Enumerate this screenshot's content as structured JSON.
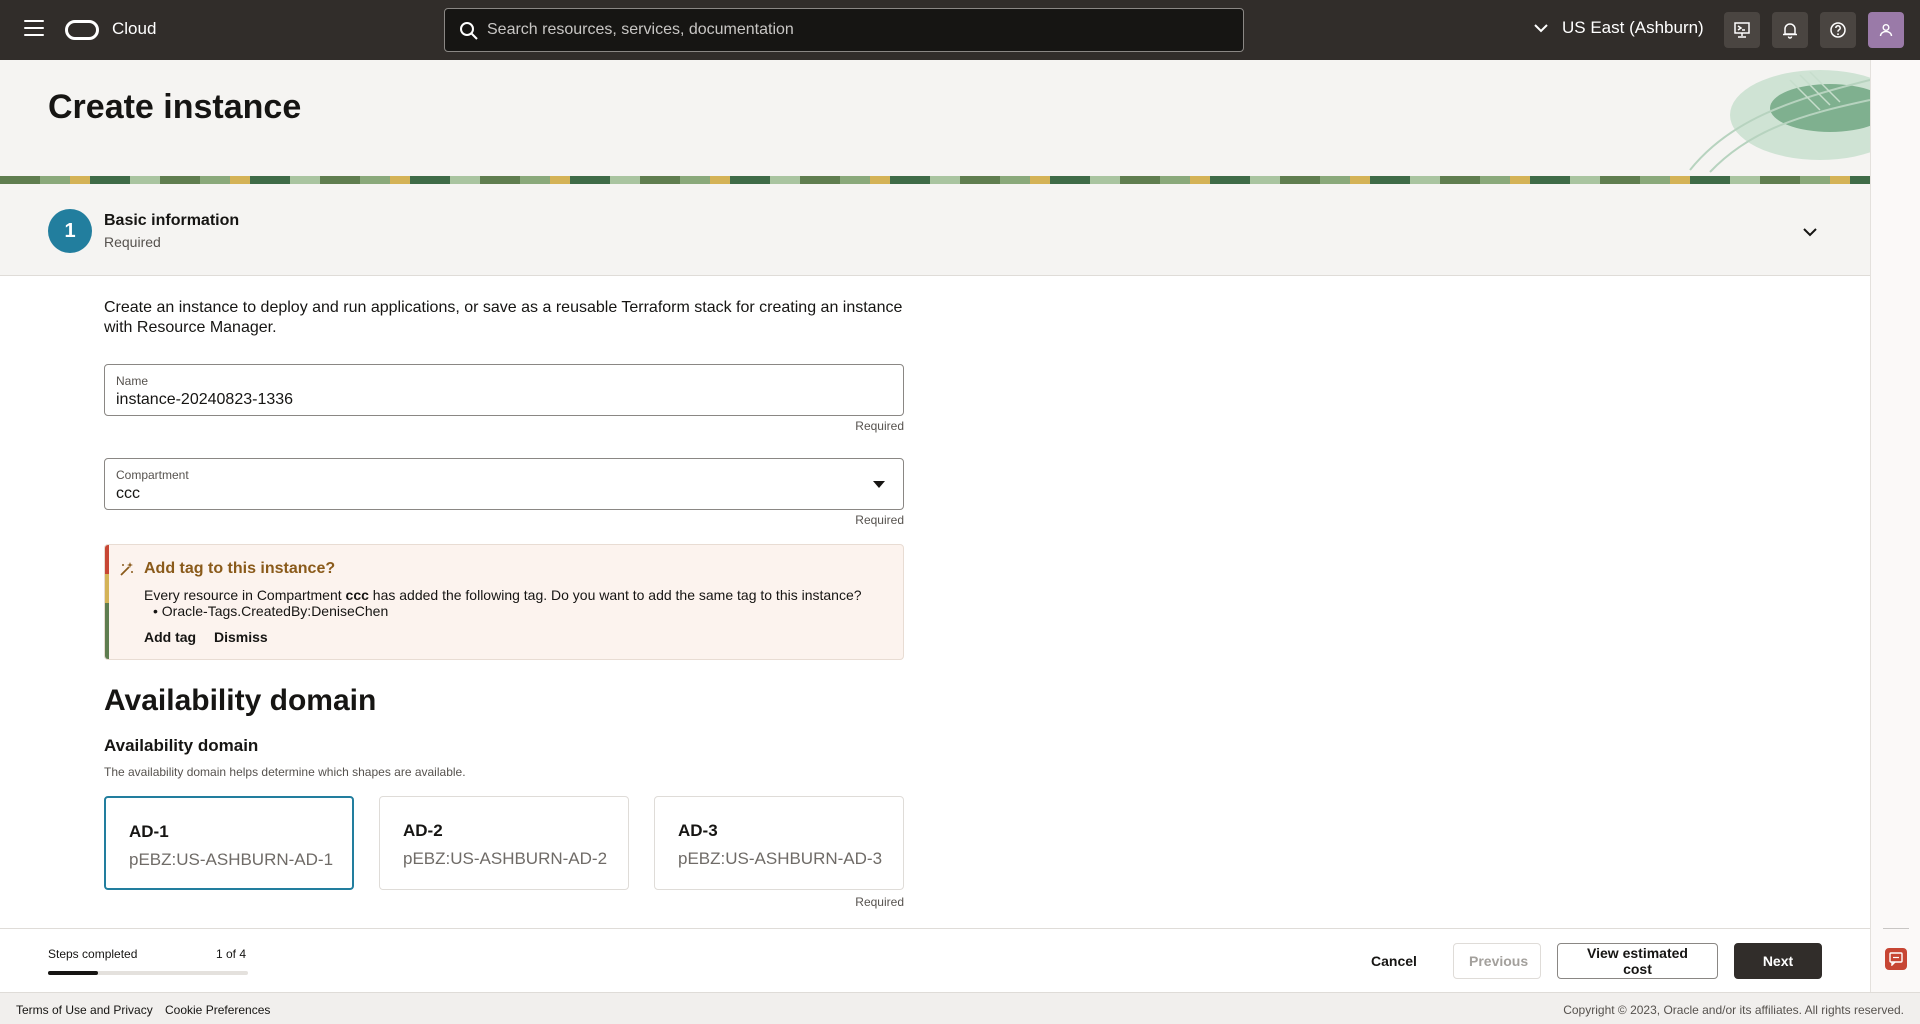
{
  "topbar": {
    "brand": "Cloud",
    "search_placeholder": "Search resources, services, documentation",
    "region": "US East (Ashburn)"
  },
  "header": {
    "title": "Create instance"
  },
  "step": {
    "number": "1",
    "title": "Basic information",
    "subtitle": "Required"
  },
  "main": {
    "intro": "Create an instance to deploy and run applications, or save as a reusable Terraform stack for creating an instance with Resource Manager.",
    "name_field": {
      "label": "Name",
      "value": "instance-20240823-1336",
      "required": "Required"
    },
    "compartment_field": {
      "label": "Compartment",
      "value": "ccc",
      "required": "Required"
    },
    "tag_suggestion": {
      "title": "Add tag to this instance?",
      "text_before": "Every resource in Compartment ",
      "compartment": "ccc",
      "text_after": " has added the following tag. Do you want to add the same tag to this instance?",
      "tag": "Oracle-Tags.CreatedBy:DeniseChen",
      "add_label": "Add tag",
      "dismiss_label": "Dismiss"
    },
    "availability": {
      "section_title": "Availability domain",
      "sub_title": "Availability domain",
      "help": "The availability domain helps determine which shapes are available.",
      "required": "Required",
      "domains": [
        {
          "name": "AD-1",
          "id": "pEBZ:US-ASHBURN-AD-1",
          "selected": true
        },
        {
          "name": "AD-2",
          "id": "pEBZ:US-ASHBURN-AD-2",
          "selected": false
        },
        {
          "name": "AD-3",
          "id": "pEBZ:US-ASHBURN-AD-3",
          "selected": false
        }
      ]
    }
  },
  "actionbar": {
    "steps_label": "Steps completed",
    "steps_count": "1 of 4",
    "progress_fraction": 0.25,
    "cancel": "Cancel",
    "previous": "Previous",
    "view_cost": "View estimated cost",
    "next": "Next"
  },
  "footer": {
    "terms": "Terms of Use and Privacy",
    "cookies": "Cookie Preferences",
    "copyright": "Copyright © 2023, Oracle and/or its affiliates. All rights reserved."
  },
  "colors": {
    "accent": "#227e9e",
    "topbar": "#312d2a",
    "tag_title": "#8a5a1a"
  },
  "icons": [
    "menu-icon",
    "cloud-logo-icon",
    "search-icon",
    "chevron-down-icon",
    "cloud-shell-icon",
    "bell-icon",
    "help-icon",
    "user-icon",
    "sparkle-icon",
    "feedback-icon"
  ]
}
